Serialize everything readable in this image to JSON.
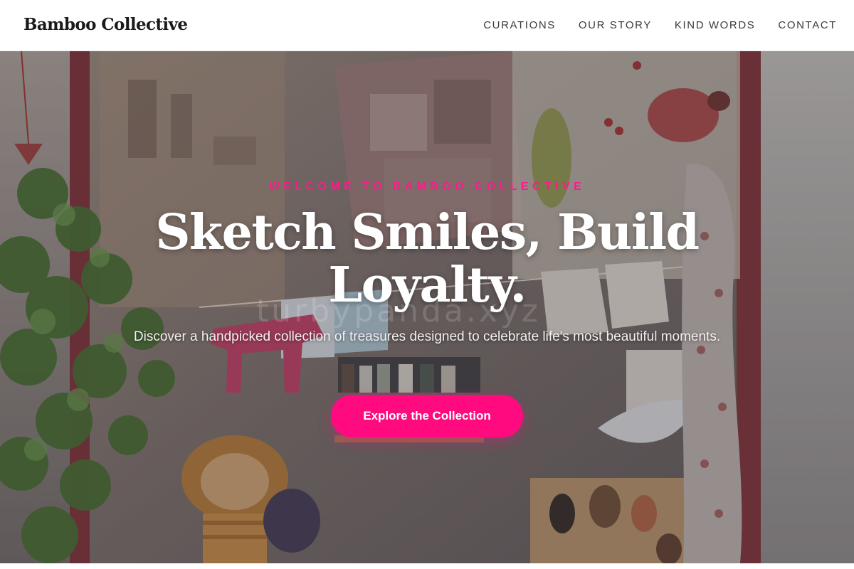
{
  "header": {
    "brand": "Bamboo Collective",
    "nav": [
      "CURATIONS",
      "OUR STORY",
      "KIND WORDS",
      "CONTACT"
    ]
  },
  "hero": {
    "eyebrow": "WELCOME TO BAMBOO COLLECTIVE",
    "headline": "Sketch Smiles, Build Loyalty.",
    "subhead": "Discover a handpicked collection of treasures designed to celebrate life's most beautiful moments.",
    "cta_label": "Explore the Collection",
    "background_image": "gift shop window display with plush toys, cushion, bird prints and ivy",
    "watermark": "turbypanda.xyz"
  },
  "colors": {
    "accent": "#ff0a7f",
    "eyebrow": "#ff1a8c",
    "text_dark": "#1a1a1a",
    "nav_text": "#3a3a3a"
  }
}
